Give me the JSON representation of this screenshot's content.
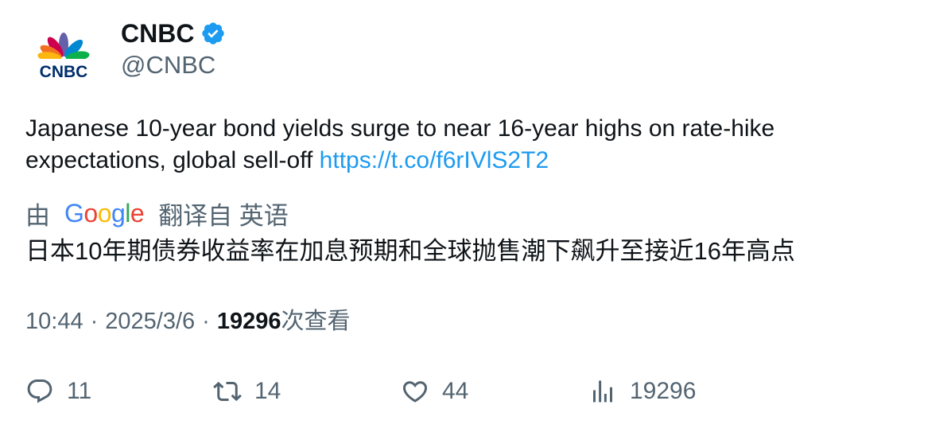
{
  "author": {
    "display_name": "CNBC",
    "handle": "@CNBC",
    "verified": true,
    "avatar_text": "CNBC",
    "avatar_icon": "cnbc-peacock-logo"
  },
  "tweet": {
    "text": "Japanese 10-year bond yields surge to near 16-year highs on rate-hike expectations, global sell-off ",
    "link": "https://t.co/f6rIVlS2T2"
  },
  "translation": {
    "prefix": "由",
    "provider_letters": [
      "G",
      "o",
      "o",
      "g",
      "l",
      "e"
    ],
    "suffix": "翻译自 英语",
    "text": "日本10年期债券收益率在加息预期和全球抛售潮下飙升至接近16年高点"
  },
  "meta": {
    "time": "10:44",
    "separator": "·",
    "date": "2025/3/6",
    "views_count": "19296",
    "views_label": "次查看"
  },
  "actions": {
    "reply_count": "11",
    "retweet_count": "14",
    "like_count": "44",
    "views_count": "19296"
  },
  "colors": {
    "text": "#0f1419",
    "secondary": "#536471",
    "link": "#1d9bf0",
    "verified": "#1d9bf0"
  }
}
